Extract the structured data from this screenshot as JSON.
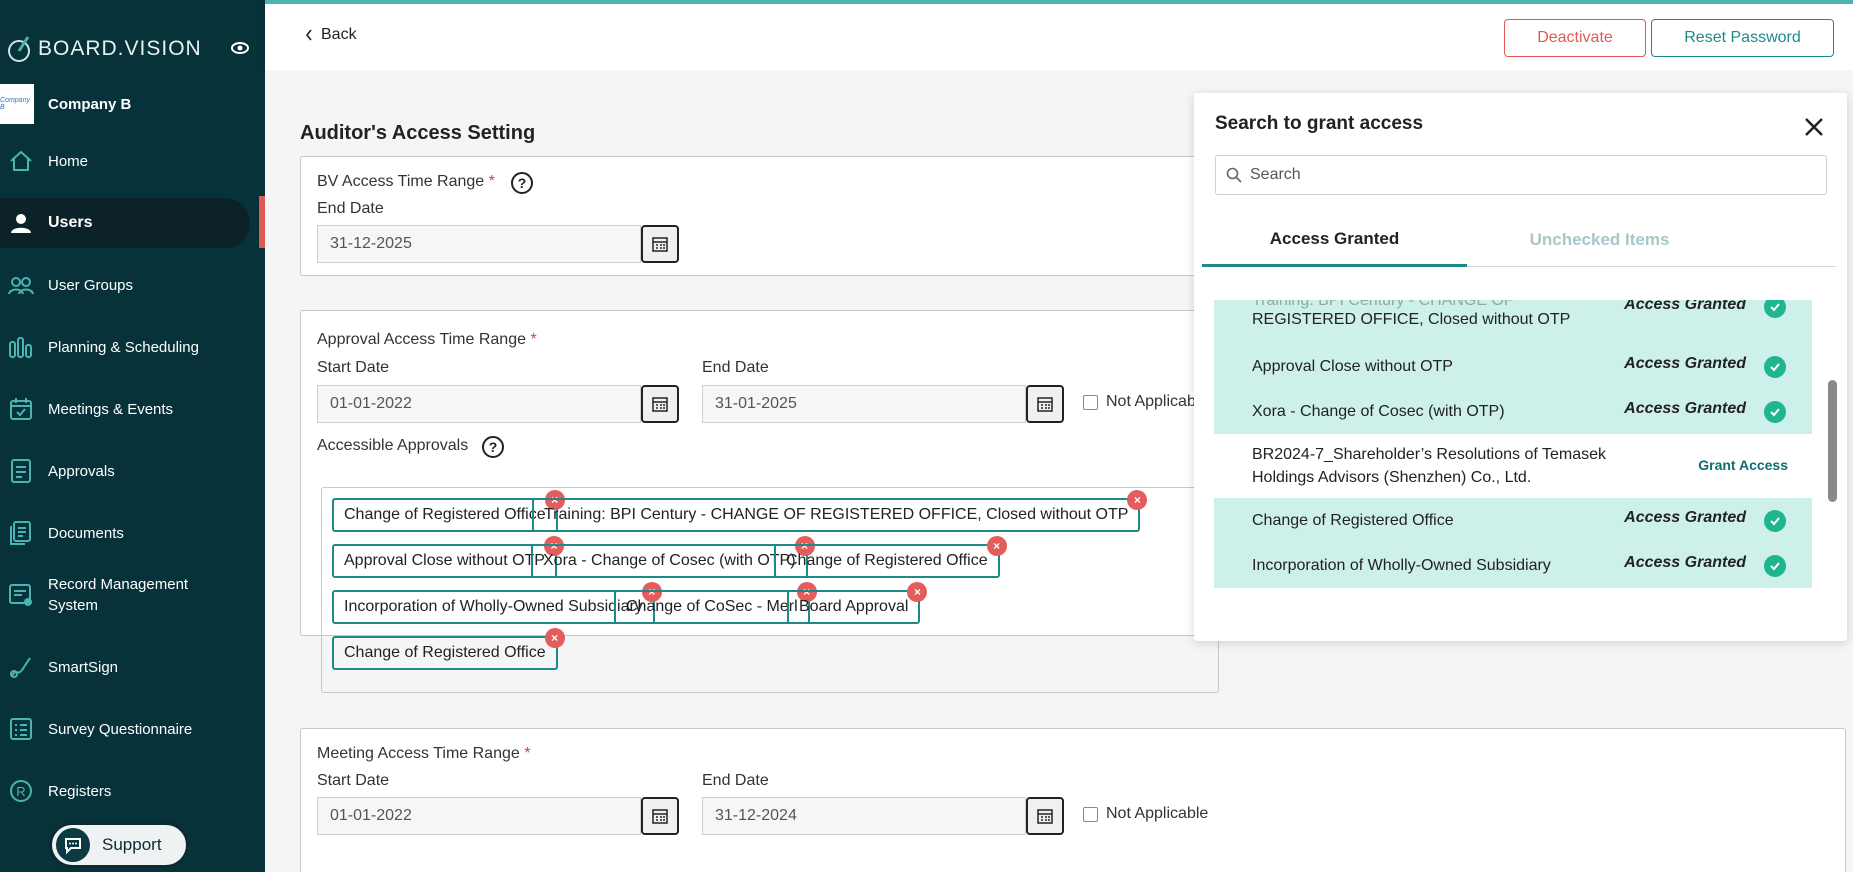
{
  "app": {
    "brand": "BOARD.VISION"
  },
  "company": {
    "name": "Company B",
    "logo_text": "Company B"
  },
  "sidebar": {
    "items": [
      {
        "label": "Home",
        "icon": "home-icon"
      },
      {
        "label": "Users",
        "icon": "user-icon",
        "active": true
      },
      {
        "label": "User Groups",
        "icon": "user-groups-icon"
      },
      {
        "label": "Planning & Scheduling",
        "icon": "bar-chart-icon"
      },
      {
        "label": "Meetings & Events",
        "icon": "calendar-check-icon"
      },
      {
        "label": "Approvals",
        "icon": "approvals-icon"
      },
      {
        "label": "Documents",
        "icon": "documents-icon"
      },
      {
        "label": "Record Management System",
        "icon": "record-icon"
      },
      {
        "label": "SmartSign",
        "icon": "signature-icon"
      },
      {
        "label": "Survey Questionnaire",
        "icon": "survey-icon"
      },
      {
        "label": "Registers",
        "icon": "registers-icon"
      }
    ],
    "support_label": "Support"
  },
  "topbar": {
    "back_label": "Back",
    "deactivate_label": "Deactivate",
    "reset_password_label": "Reset Password"
  },
  "main": {
    "title": "Auditor's Access Setting",
    "bv_access": {
      "label": "BV Access Time Range",
      "end_label": "End Date",
      "end_value": "31-12-2025"
    },
    "approval_access": {
      "label": "Approval Access Time Range",
      "start_label": "Start Date",
      "start_value": "01-01-2022",
      "end_label": "End Date",
      "end_value": "31-01-2025",
      "not_applicable_label": "Not Applicable",
      "accessible_label": "Accessible Approvals",
      "chips": [
        "Change of Registered Office",
        "Training: BPI Century - CHANGE OF REGISTERED OFFICE, Closed without OTP",
        "Approval Close without OTP",
        "Xora - Change of Cosec (with OTP)",
        "Change of Registered Office",
        "Incorporation of Wholly-Owned Subsidiary",
        "Change of CoSec - Merl",
        "Board Approval",
        "Change of Registered Office"
      ]
    },
    "meeting_access": {
      "label": "Meeting Access Time Range",
      "start_label": "Start Date",
      "start_value": "01-01-2022",
      "end_label": "End Date",
      "end_value": "31-12-2024",
      "not_applicable_label": "Not Applicable"
    }
  },
  "panel": {
    "title": "Search to grant access",
    "search_placeholder": "Search",
    "tabs": [
      "Access Granted",
      "Unchecked Items"
    ],
    "rows": [
      {
        "line1": "Training: BPI Century - CHANGE OF",
        "line2": "REGISTERED OFFICE, Closed without OTP",
        "status": "Access Granted"
      },
      {
        "line1": "Approval Close without OTP",
        "status": "Access Granted"
      },
      {
        "line1": "Xora - Change of Cosec (with OTP)",
        "status": "Access Granted"
      },
      {
        "line1": "BR2024-7_Shareholder’s Resolutions of Temasek",
        "line2": "Holdings Advisors (Shenzhen) Co., Ltd.",
        "action": "Grant Access"
      },
      {
        "line1": "Change of Registered Office",
        "status": "Access Granted"
      },
      {
        "line1": "Incorporation of Wholly-Owned Subsidiary",
        "status": "Access Granted"
      }
    ]
  }
}
